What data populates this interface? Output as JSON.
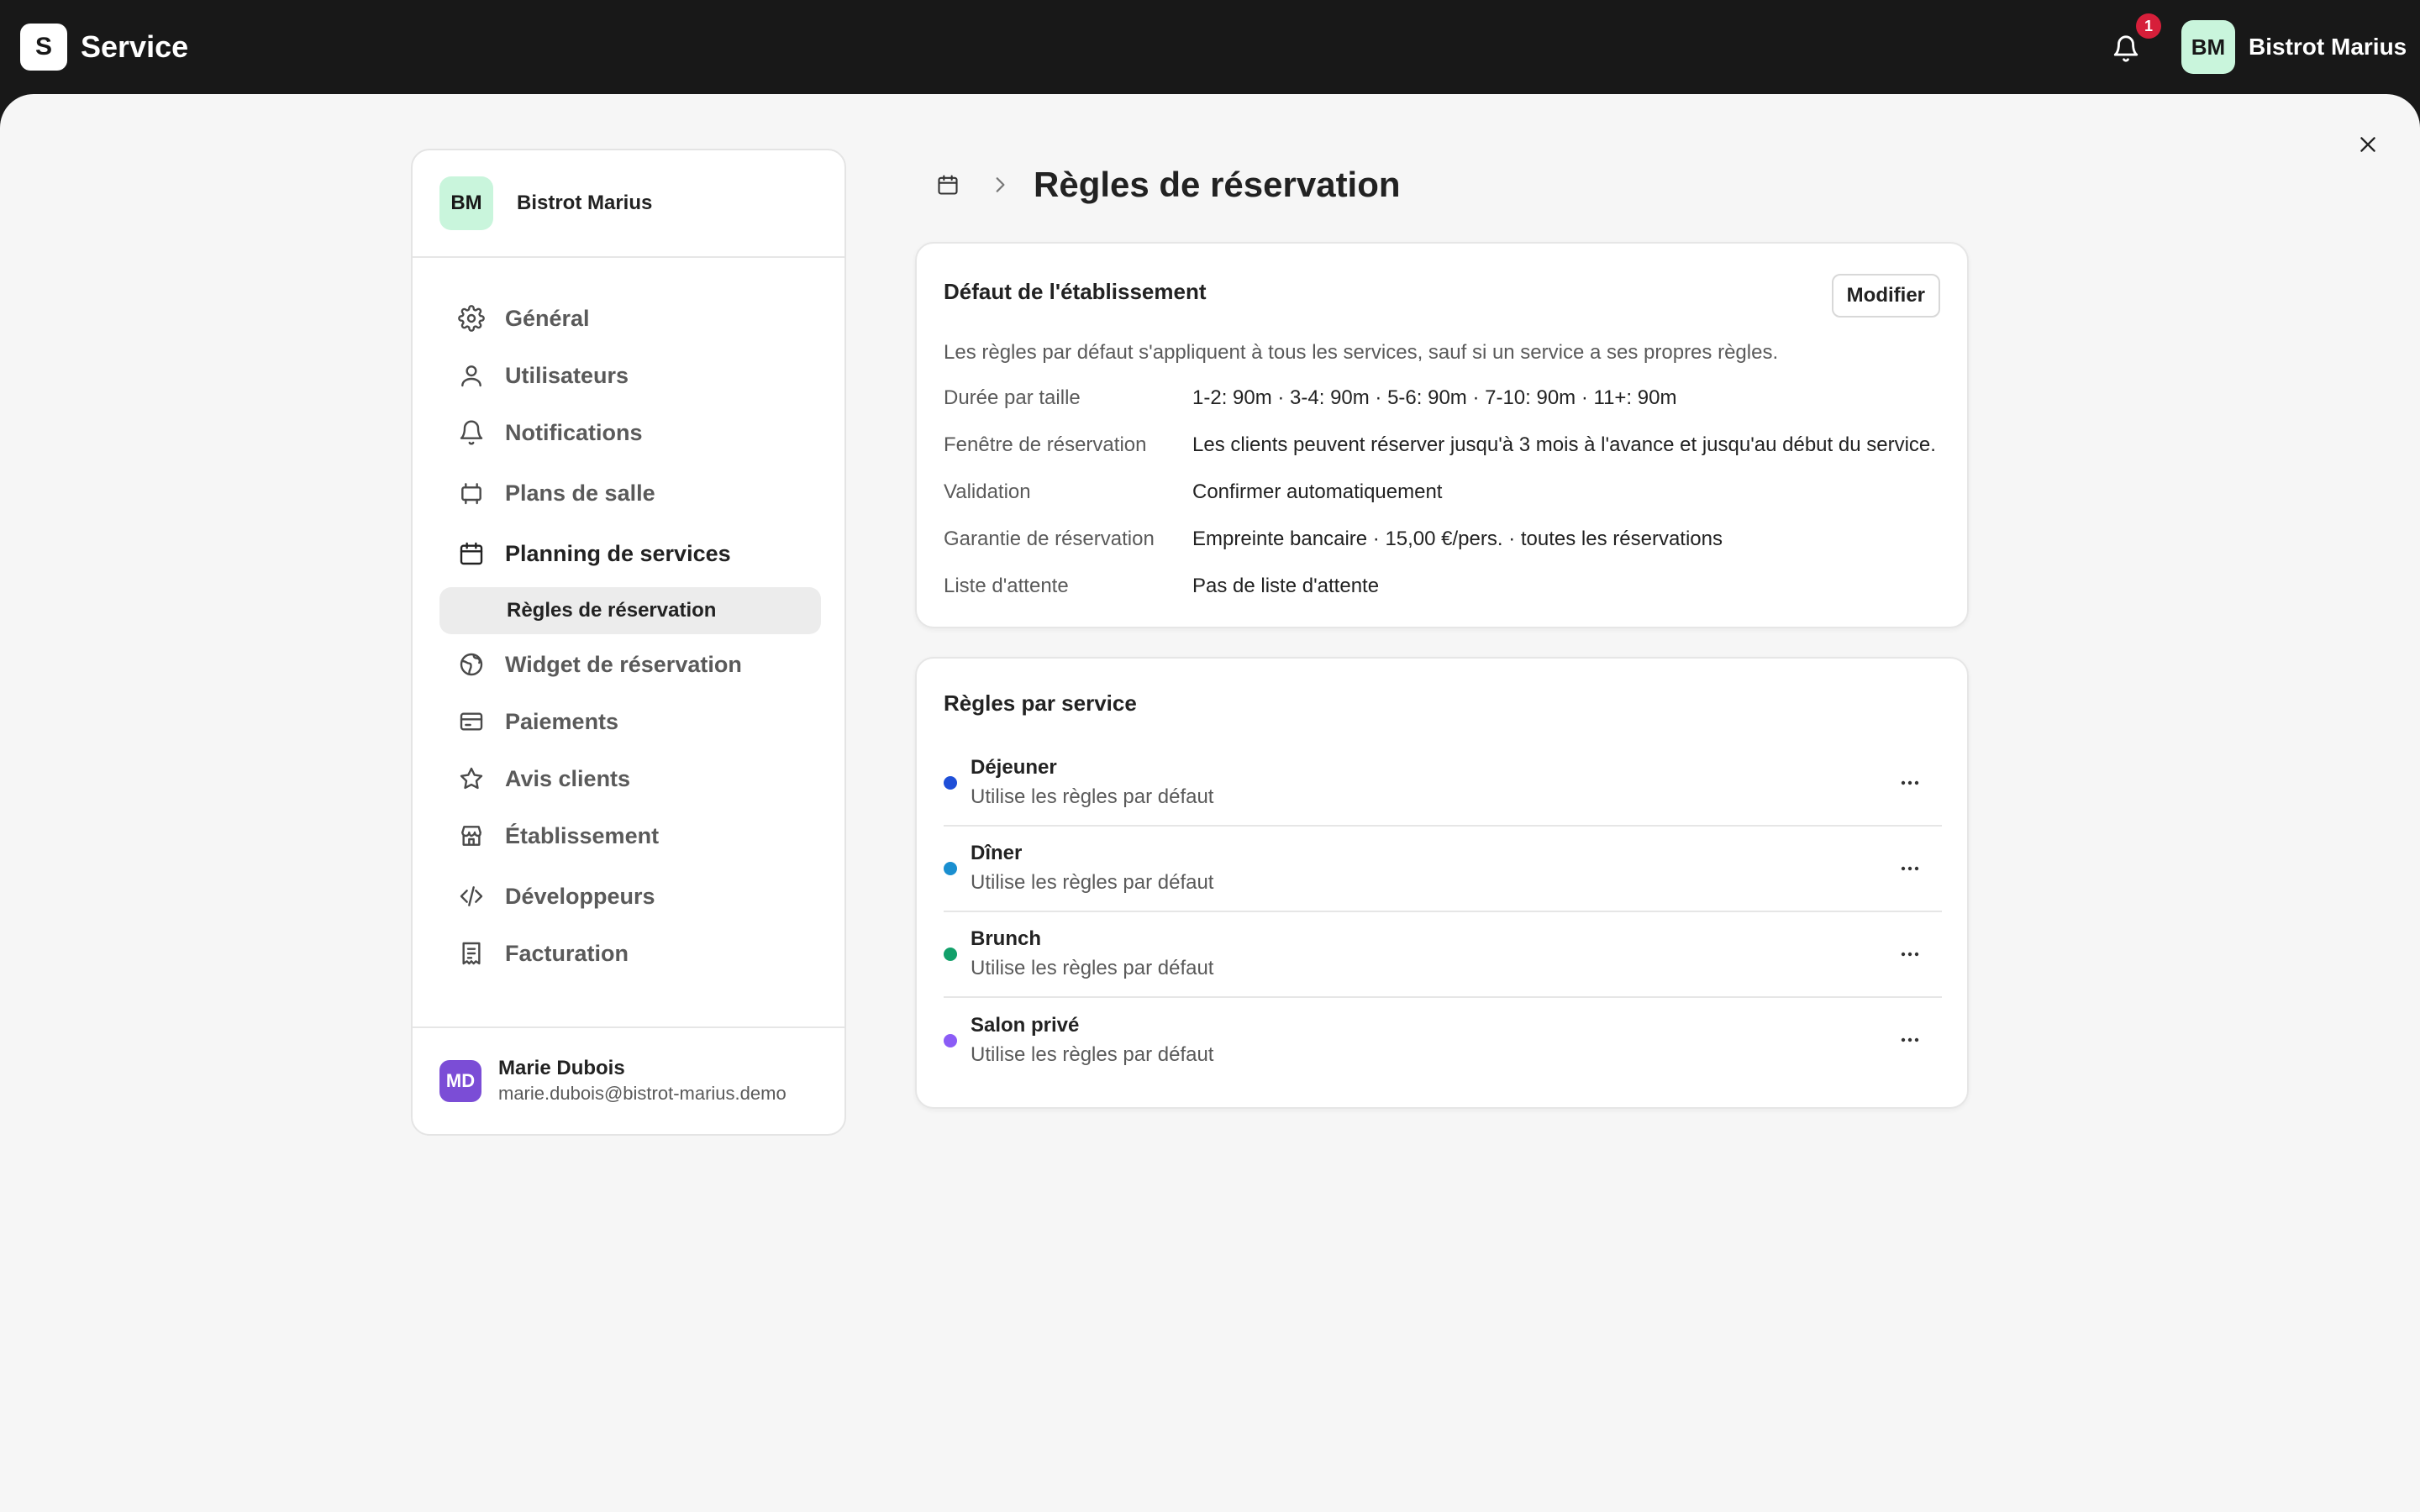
{
  "app": {
    "logo_letter": "S",
    "title": "Service"
  },
  "topbar": {
    "notifications_count": "1",
    "avatar_initials": "BM",
    "account_name": "Bistrot Marius"
  },
  "sidebar": {
    "org_initials": "BM",
    "org_name": "Bistrot Marius",
    "items": [
      {
        "label": "Général",
        "icon": "gear-icon"
      },
      {
        "label": "Utilisateurs",
        "icon": "user-icon"
      },
      {
        "label": "Notifications",
        "icon": "bell-icon"
      },
      {
        "label": "Plans de salle",
        "icon": "floor-plan-icon"
      },
      {
        "label": "Planning de services",
        "icon": "calendar-icon"
      },
      {
        "label": "Règles de réservation",
        "icon": ""
      },
      {
        "label": "Widget de réservation",
        "icon": "globe-icon"
      },
      {
        "label": "Paiements",
        "icon": "credit-card-icon"
      },
      {
        "label": "Avis clients",
        "icon": "star-icon"
      },
      {
        "label": "Établissement",
        "icon": "store-icon"
      },
      {
        "label": "Développeurs",
        "icon": "code-icon"
      },
      {
        "label": "Facturation",
        "icon": "receipt-icon"
      }
    ],
    "user": {
      "initials": "MD",
      "name": "Marie Dubois",
      "email": "marie.dubois@bistrot-marius.demo"
    }
  },
  "page": {
    "title": "Règles de réservation"
  },
  "defaults_card": {
    "title": "Défaut de l'établissement",
    "modify_label": "Modifier",
    "description": "Les règles par défaut s'appliquent à tous les services, sauf si un service a ses propres règles.",
    "rows": [
      {
        "key": "Durée par taille",
        "value": "1-2: 90m · 3-4: 90m · 5-6: 90m · 7-10: 90m · 11+: 90m"
      },
      {
        "key": "Fenêtre de réservation",
        "value": "Les clients peuvent réserver jusqu'à 3 mois à l'avance et jusqu'au début du service."
      },
      {
        "key": "Validation",
        "value": "Confirmer automatiquement"
      },
      {
        "key": "Garantie de réservation",
        "value": "Empreinte bancaire · 15,00 €/pers. · toutes les réservations"
      },
      {
        "key": "Liste d'attente",
        "value": "Pas de liste d'attente"
      }
    ]
  },
  "services_card": {
    "title": "Règles par service",
    "services": [
      {
        "name": "Déjeuner",
        "subtitle": "Utilise les règles par défaut",
        "color": "#1f4fd8"
      },
      {
        "name": "Dîner",
        "subtitle": "Utilise les règles par défaut",
        "color": "#1a8fd0"
      },
      {
        "name": "Brunch",
        "subtitle": "Utilise les règles par défaut",
        "color": "#12a06a"
      },
      {
        "name": "Salon privé",
        "subtitle": "Utilise les règles par défaut",
        "color": "#8b5cf6"
      }
    ]
  },
  "colors": {
    "topbar_bg": "#181818",
    "badge_red": "#d61f3a",
    "avatar_mint": "#c9f5dc",
    "user_avatar_purple": "#7b4dd6"
  }
}
